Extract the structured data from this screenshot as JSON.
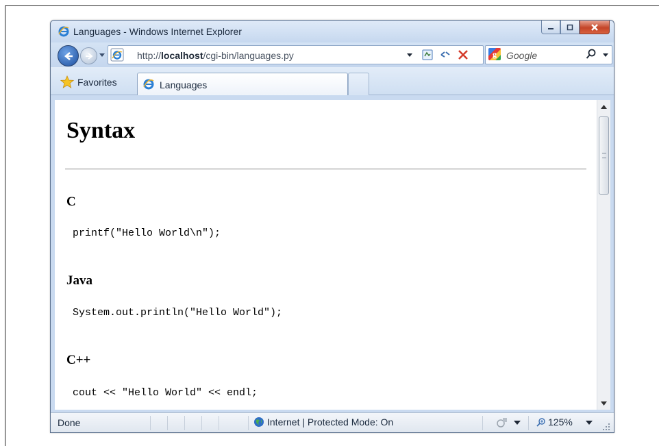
{
  "window": {
    "title": "Languages - Windows Internet Explorer"
  },
  "address_bar": {
    "url_prefix": "http://",
    "url_host": "localhost",
    "url_path": "/cgi-bin/languages.py"
  },
  "search": {
    "placeholder": "Google"
  },
  "favorites_bar": {
    "favorites_label": "Favorites",
    "tabs": [
      {
        "label": "Languages"
      }
    ]
  },
  "page": {
    "heading": "Syntax",
    "sections": [
      {
        "language": "C",
        "code": "printf(\"Hello World\\n\");"
      },
      {
        "language": "Java",
        "code": "System.out.println(\"Hello World\");"
      },
      {
        "language": "C++",
        "code": "cout << \"Hello World\" << endl;"
      }
    ]
  },
  "status_bar": {
    "status": "Done",
    "zone": "Internet | Protected Mode: On",
    "zoom": "125%"
  }
}
